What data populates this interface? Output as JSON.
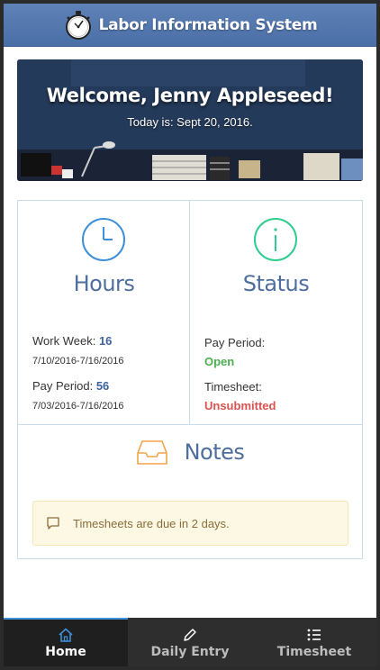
{
  "header": {
    "title": "Labor Information System",
    "logo_icon": "stopwatch-icon"
  },
  "hero": {
    "welcome": "Welcome, Jenny Appleseed!",
    "today": "Today is: Sept 20, 2016."
  },
  "hours": {
    "heading": "Hours",
    "icon": "clock-icon",
    "work_week_label": "Work Week:",
    "work_week_value": "16",
    "work_week_range": "7/10/2016-7/16/2016",
    "pay_period_label": "Pay Period:",
    "pay_period_value": "56",
    "pay_period_range": "7/03/2016-7/16/2016"
  },
  "status": {
    "heading": "Status",
    "icon": "info-icon",
    "pay_period_label": "Pay Period:",
    "pay_period_value": "Open",
    "timesheet_label": "Timesheet:",
    "timesheet_value": "Unsubmitted"
  },
  "notes": {
    "heading": "Notes",
    "icon": "inbox-icon",
    "alert_icon": "comment-icon",
    "alert_text": "Timesheets are due in 2 days."
  },
  "nav": {
    "items": [
      {
        "label": "Home",
        "icon": "home-icon",
        "active": true
      },
      {
        "label": "Daily Entry",
        "icon": "pencil-icon",
        "active": false
      },
      {
        "label": "Timesheet",
        "icon": "list-icon",
        "active": false
      }
    ]
  },
  "colors": {
    "header": "#4a6ea6",
    "accent_blue": "#3d8fd8",
    "heading": "#4e6e9e",
    "open_green": "#4caf50",
    "unsubmitted_red": "#d9534f",
    "alert_bg": "#fcf8e3"
  }
}
